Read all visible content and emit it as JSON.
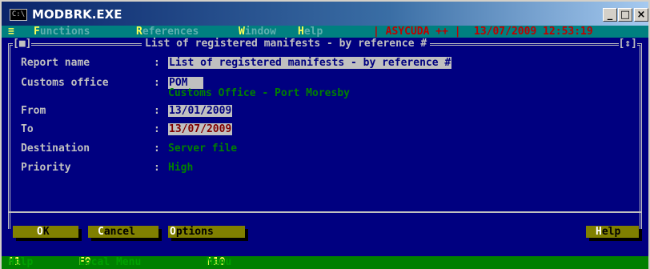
{
  "window": {
    "title": "MODBRK.EXE",
    "icon_text": "C:\\",
    "minimize": "_",
    "maximize": "□",
    "close": "×"
  },
  "menubar": {
    "system": "≡",
    "items": [
      {
        "key": "F",
        "rest": "unctions"
      },
      {
        "key": "R",
        "rest": "eferences"
      },
      {
        "key": "W",
        "rest": "indow"
      },
      {
        "key": "H",
        "rest": "elp"
      }
    ],
    "app": "| ASYCUDA ++ |",
    "datetime": "13/07/2009 12:53:19"
  },
  "dialog": {
    "left_marker": "[■]",
    "title": "List of registered manifests - by reference #",
    "right_marker": "[↕]"
  },
  "form": {
    "report_name": {
      "label": "Report name",
      "value": "List of registered manifests - by reference #"
    },
    "customs_office": {
      "label": "Customs office",
      "code": "POM",
      "name": "Customs Office - Port Moresby"
    },
    "from": {
      "label": "From",
      "value": "13/01/2009"
    },
    "to": {
      "label": "To",
      "value": "13/07/2009"
    },
    "destination": {
      "label": "Destination",
      "value": "Server file"
    },
    "priority": {
      "label": "Priority",
      "value": "High"
    }
  },
  "buttons": {
    "ok": {
      "key": "O",
      "rest": "K"
    },
    "cancel": {
      "key": "C",
      "rest": "ancel"
    },
    "options": {
      "key": "O",
      "rest": "ptions"
    },
    "help": {
      "key": "H",
      "rest": "elp"
    }
  },
  "statusbar": [
    {
      "key": "F1",
      "desc": "Help"
    },
    {
      "key": "F9",
      "desc": "Local Menu"
    },
    {
      "key": "F10",
      "desc": "Menu"
    }
  ],
  "colors": {
    "screen": "#000080",
    "menubar": "#008080",
    "status": "#008000",
    "button": "#808000",
    "hotkey": "#ffff55"
  }
}
